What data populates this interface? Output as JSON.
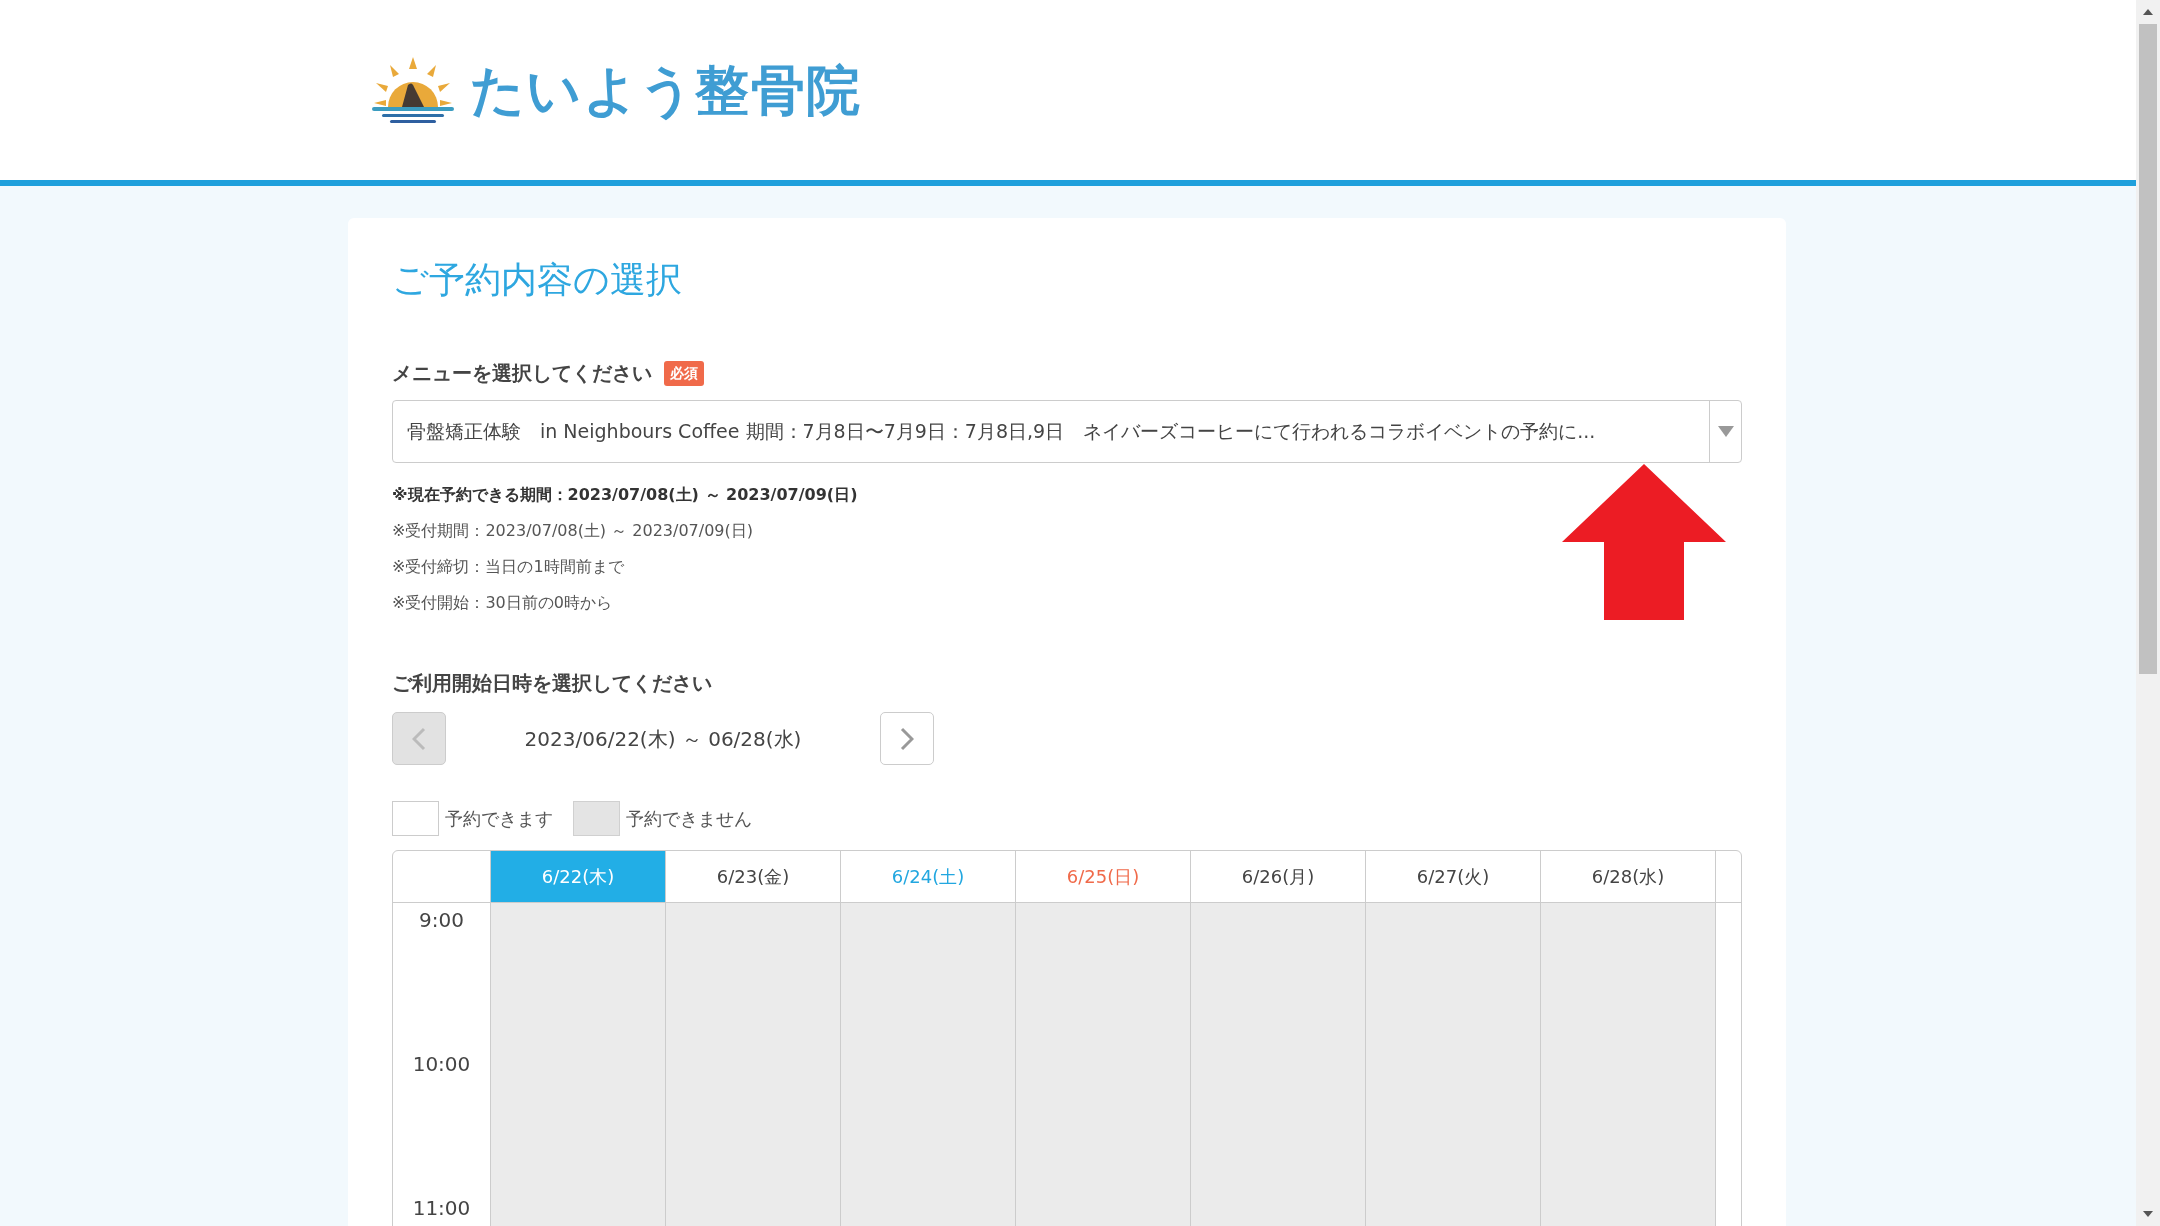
{
  "header": {
    "logo_text": "たいよう整骨院"
  },
  "title": "ご予約内容の選択",
  "menu": {
    "label": "メニューを選択してください",
    "required_badge": "必須",
    "value": "骨盤矯正体験　in Neighbours Coffee 期間：7月8日〜7月9日：7月8日,9日　ネイバーズコーヒーにて行われるコラボイベントの予約に..."
  },
  "notes": [
    {
      "text": "※現在予約できる期間：2023/07/08(土) ～ 2023/07/09(日)",
      "bold": true
    },
    {
      "text": "※受付期間：2023/07/08(土) ～ 2023/07/09(日)",
      "bold": false
    },
    {
      "text": "※受付締切：当日の1時間前まで",
      "bold": false
    },
    {
      "text": "※受付開始：30日前の0時から",
      "bold": false
    }
  ],
  "date_section": {
    "label": "ご利用開始日時を選択してください",
    "range": "2023/06/22(木) ～ 06/28(水)",
    "prev_disabled": true,
    "next_disabled": false
  },
  "legend": [
    {
      "label": "予約できます",
      "available": true
    },
    {
      "label": "予約できません",
      "available": false
    }
  ],
  "days": [
    {
      "label": "6/22(木)",
      "kind": "weekday",
      "selected": true
    },
    {
      "label": "6/23(金)",
      "kind": "weekday",
      "selected": false
    },
    {
      "label": "6/24(土)",
      "kind": "saturday",
      "selected": false
    },
    {
      "label": "6/25(日)",
      "kind": "sunday",
      "selected": false
    },
    {
      "label": "6/26(月)",
      "kind": "weekday",
      "selected": false
    },
    {
      "label": "6/27(火)",
      "kind": "weekday",
      "selected": false
    },
    {
      "label": "6/28(水)",
      "kind": "weekday",
      "selected": false
    }
  ],
  "times": [
    "9:00",
    "10:00",
    "11:00"
  ]
}
